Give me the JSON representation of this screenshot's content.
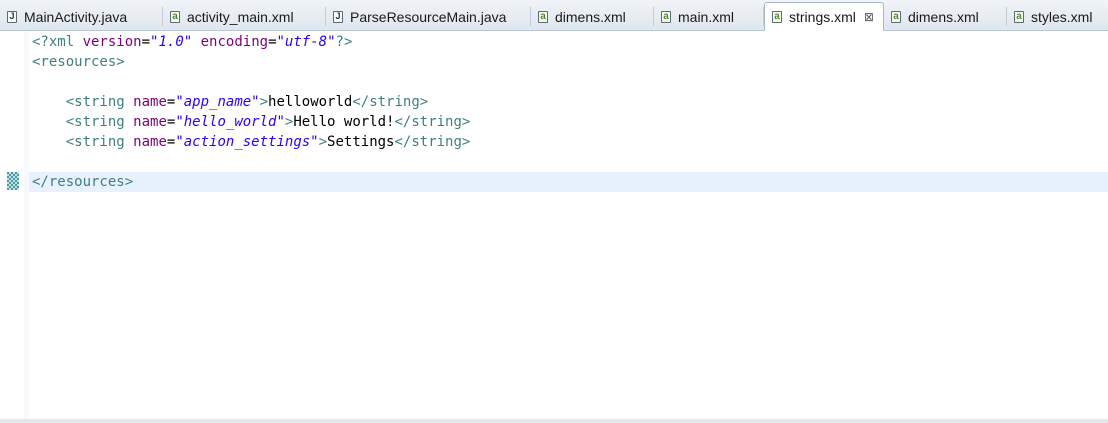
{
  "tabs": [
    {
      "label": "MainActivity.java",
      "kind": "java",
      "icon": "java-file-icon",
      "glyph": "J"
    },
    {
      "label": "activity_main.xml",
      "kind": "xml",
      "icon": "xml-file-icon",
      "glyph": "a"
    },
    {
      "label": "ParseResourceMain.java",
      "kind": "java",
      "icon": "java-file-icon",
      "glyph": "J"
    },
    {
      "label": "dimens.xml",
      "kind": "xml",
      "icon": "xml-file-icon",
      "glyph": "a"
    },
    {
      "label": "main.xml",
      "kind": "xml",
      "icon": "xml-file-icon",
      "glyph": "a"
    },
    {
      "label": "strings.xml",
      "kind": "xml",
      "icon": "xml-file-icon",
      "glyph": "a",
      "active": true,
      "close": "⊠"
    },
    {
      "label": "dimens.xml",
      "kind": "xml",
      "icon": "xml-file-icon",
      "glyph": "a"
    },
    {
      "label": "styles.xml",
      "kind": "xml",
      "icon": "xml-file-icon",
      "glyph": "a"
    }
  ],
  "editor": {
    "lines": [
      {
        "pi_open": "<?xml ",
        "attr1": "version",
        "eq1": "=",
        "val1": "\"1.0\"",
        "sp": " ",
        "attr2": "encoding",
        "eq2": "=",
        "val2": "\"utf-8\"",
        "pi_close": "?>"
      },
      {
        "tag": "<resources>"
      },
      {},
      {
        "indent": "    ",
        "open": "<string ",
        "attr": "name",
        "eq": "=",
        "val": "\"app_name\"",
        "gt": ">",
        "text": "helloworld",
        "close": "</string>"
      },
      {
        "indent": "    ",
        "open": "<string ",
        "attr": "name",
        "eq": "=",
        "val": "\"hello_world\"",
        "gt": ">",
        "text": "Hello world!",
        "close": "</string>"
      },
      {
        "indent": "    ",
        "open": "<string ",
        "attr": "name",
        "eq": "=",
        "val": "\"action_settings\"",
        "gt": ">",
        "text": "Settings",
        "close": "</string>"
      },
      {},
      {
        "tag": "</resources>"
      }
    ],
    "current_line": 8
  },
  "colors": {
    "tag": "#3f7f7f",
    "attribute": "#7f007f",
    "value": "#2a00ff",
    "current_line": "#e8f2fe"
  }
}
